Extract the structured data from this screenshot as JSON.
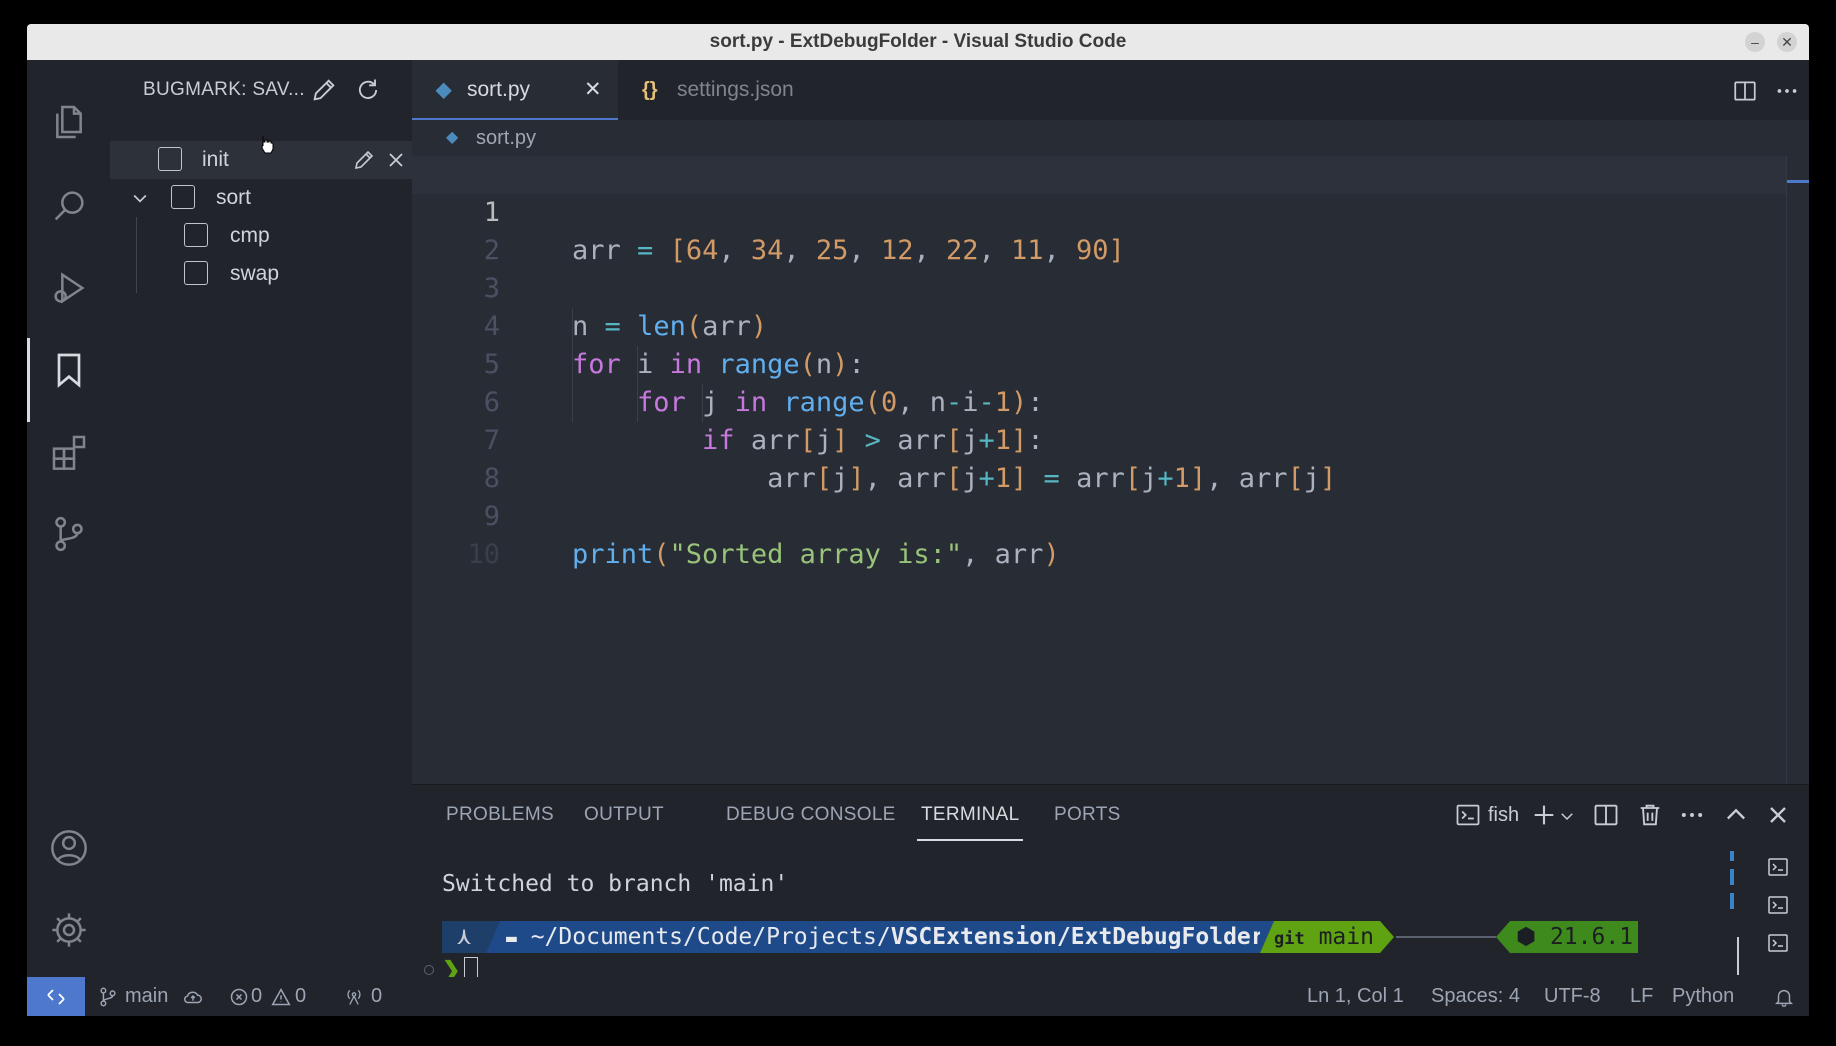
{
  "window": {
    "title": "sort.py - ExtDebugFolder - Visual Studio Code"
  },
  "sidebar": {
    "title": "BUGMARK: SAV...",
    "items": [
      {
        "label": "init"
      },
      {
        "label": "sort"
      },
      {
        "label": "cmp"
      },
      {
        "label": "swap"
      }
    ]
  },
  "tabs": [
    {
      "label": "sort.py",
      "icon": "python-icon"
    },
    {
      "label": "settings.json",
      "icon": "json-icon"
    }
  ],
  "breadcrumb": {
    "file": "sort.py"
  },
  "editor": {
    "line_numbers": [
      "1",
      "2",
      "3",
      "4",
      "5",
      "6",
      "7",
      "8",
      "9",
      "10"
    ]
  },
  "panel": {
    "tabs": [
      "PROBLEMS",
      "OUTPUT",
      "DEBUG CONSOLE",
      "TERMINAL",
      "PORTS"
    ],
    "shell": "fish",
    "terminal_output": "Switched to branch 'main'",
    "prompt": {
      "path_prefix": "~/Documents/Code/Projects/",
      "path_bold": "VSCExtension/ExtDebugFolder",
      "git_label": "git",
      "branch": "main",
      "node_version": "21.6.1"
    }
  },
  "statusbar": {
    "branch": "main",
    "errors": "0",
    "warnings": "0",
    "ports": "0",
    "position": "Ln 1, Col 1",
    "spaces": "Spaces: 4",
    "encoding": "UTF-8",
    "eol": "LF",
    "language": "Python"
  },
  "colors": {
    "accent": "#4d78cc",
    "prompt_path_bg": "#1f4a8a",
    "prompt_git_bg": "#5fa313",
    "prompt_node_bg": "#3f8a1d"
  }
}
